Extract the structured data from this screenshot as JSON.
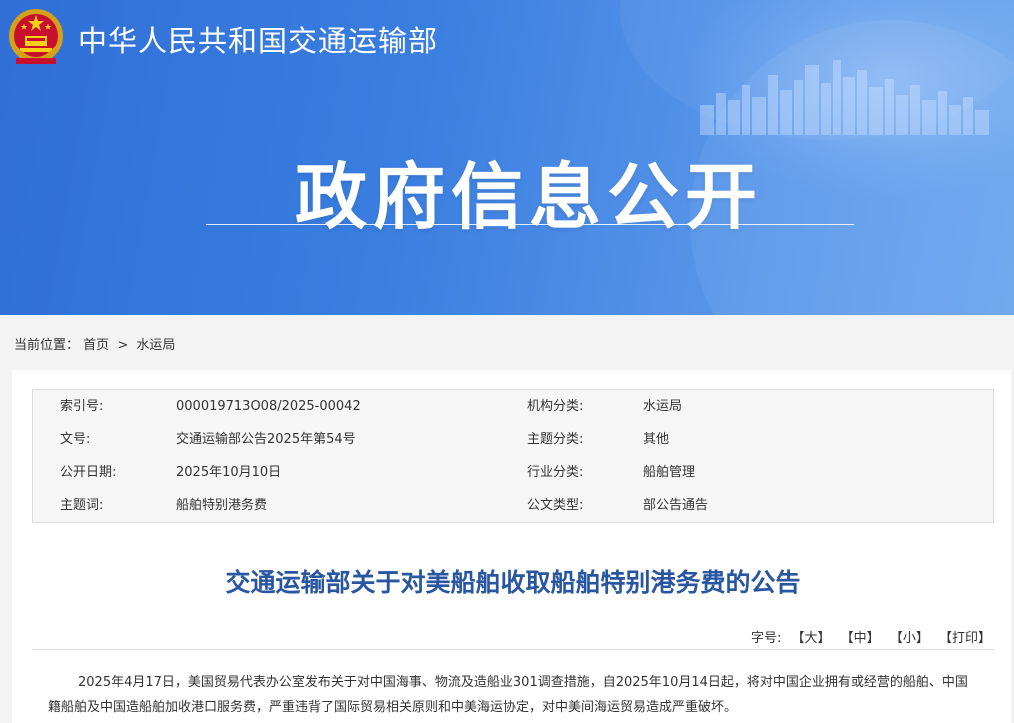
{
  "header": {
    "site_title": "中华人民共和国交通运输部",
    "hero_title": "政府信息公开"
  },
  "breadcrumb": {
    "label": "当前位置：",
    "home": "首页",
    "separator": ">",
    "current": "水运局"
  },
  "meta": {
    "rows": [
      {
        "k1": "索引号:",
        "v1": "000019713O08/2025-00042",
        "k2": "机构分类:",
        "v2": "水运局"
      },
      {
        "k1": "文号:",
        "v1": "交通运输部公告2025年第54号",
        "k2": "主题分类:",
        "v2": "其他"
      },
      {
        "k1": "公开日期:",
        "v1": "2025年10月10日",
        "k2": "行业分类:",
        "v2": "船舶管理"
      },
      {
        "k1": "主题词:",
        "v1": "船舶特别港务费",
        "k2": "公文类型:",
        "v2": "部公告通告"
      }
    ]
  },
  "article": {
    "title": "交通运输部关于对美船舶收取船舶特别港务费的公告",
    "body": "2025年4月17日，美国贸易代表办公室发布关于对中国海事、物流及造船业301调查措施，自2025年10月14日起，将对中国企业拥有或经营的船舶、中国籍船舶及中国造船舶加收港口服务费，严重违背了国际贸易相关原则和中美海运协定，对中美间海运贸易造成严重破坏。"
  },
  "font_size": {
    "label": "字号:",
    "large": "【大】",
    "medium": "【中】",
    "small": "【小】",
    "print": "【打印】"
  },
  "colors": {
    "banner": "#3a7ee0",
    "title": "#2856a0"
  }
}
